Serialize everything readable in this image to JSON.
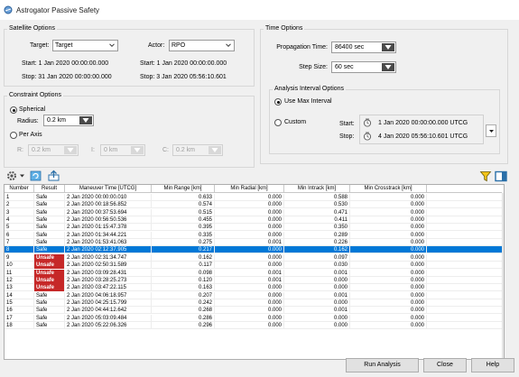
{
  "window": {
    "title": "Astrogator Passive Safety"
  },
  "satellite_options": {
    "title": "Satellite Options",
    "target_label": "Target:",
    "target_value": "Target",
    "actor_label": "Actor:",
    "actor_value": "RPO",
    "target_start": "Start: 1 Jan 2020 00:00:00.000",
    "target_stop": "Stop: 31 Jan 2020 00:00:00.000",
    "actor_start": "Start: 1 Jan 2020 00:00:00.000",
    "actor_stop": "Stop: 3 Jan 2020 05:56:10.601"
  },
  "constraint_options": {
    "title": "Constraint Options",
    "spherical_label": "Spherical",
    "radius_label": "Radius:",
    "radius_value": "0.2 km",
    "per_axis_label": "Per Axis",
    "r_label": "R:",
    "r_value": "0.2 km",
    "i_label": "I:",
    "i_value": "0 km",
    "c_label": "C:",
    "c_value": "0.2 km"
  },
  "time_options": {
    "title": "Time Options",
    "propagation_time_label": "Propagation Time:",
    "propagation_time_value": "86400 sec",
    "step_size_label": "Step Size:",
    "step_size_value": "60 sec",
    "analysis_interval": {
      "title": "Analysis Interval Options",
      "use_max_label": "Use Max Interval",
      "custom_label": "Custom",
      "start_label": "Start:",
      "start_value": "1 Jan 2020 00:00:00.000 UTCG",
      "stop_label": "Stop:",
      "stop_value": "4 Jan 2020 05:56:10.601 UTCG"
    }
  },
  "table": {
    "headers": [
      "Number",
      "Result",
      "Maneuver Time [UTCG]",
      "Min Range [km]",
      "Min Radial [km]",
      "Min Intrack [km]",
      "Min Crosstrack [km]"
    ],
    "rows": [
      [
        "1",
        "Safe",
        "2 Jan 2020 00:00:00.010",
        "0.633",
        "0.000",
        "0.588",
        "0.000"
      ],
      [
        "2",
        "Safe",
        "2 Jan 2020 00:18:56.852",
        "0.574",
        "0.000",
        "0.530",
        "0.000"
      ],
      [
        "3",
        "Safe",
        "2 Jan 2020 00:37:53.694",
        "0.515",
        "0.000",
        "0.471",
        "0.000"
      ],
      [
        "4",
        "Safe",
        "2 Jan 2020 00:56:50.536",
        "0.455",
        "0.000",
        "0.411",
        "0.000"
      ],
      [
        "5",
        "Safe",
        "2 Jan 2020 01:15:47.378",
        "0.395",
        "0.000",
        "0.350",
        "0.000"
      ],
      [
        "6",
        "Safe",
        "2 Jan 2020 01:34:44.221",
        "0.335",
        "0.000",
        "0.289",
        "0.000"
      ],
      [
        "7",
        "Safe",
        "2 Jan 2020 01:53:41.063",
        "0.275",
        "0.001",
        "0.226",
        "0.000"
      ],
      [
        "8",
        "Safe",
        "2 Jan 2020 02:12:37.905",
        "0.217",
        "0.000",
        "0.162",
        "0.000"
      ],
      [
        "9",
        "Unsafe",
        "2 Jan 2020 02:31:34.747",
        "0.162",
        "0.000",
        "0.097",
        "0.000"
      ],
      [
        "10",
        "Unsafe",
        "2 Jan 2020 02:50:31.589",
        "0.117",
        "0.000",
        "0.030",
        "0.000"
      ],
      [
        "11",
        "Unsafe",
        "2 Jan 2020 03:09:28.431",
        "0.098",
        "0.001",
        "0.001",
        "0.000"
      ],
      [
        "12",
        "Unsafe",
        "2 Jan 2020 03:28:25.273",
        "0.120",
        "0.001",
        "0.000",
        "0.000"
      ],
      [
        "13",
        "Unsafe",
        "2 Jan 2020 03:47:22.115",
        "0.163",
        "0.000",
        "0.000",
        "0.000"
      ],
      [
        "14",
        "Safe",
        "2 Jan 2020 04:06:18.957",
        "0.207",
        "0.000",
        "0.001",
        "0.000"
      ],
      [
        "15",
        "Safe",
        "2 Jan 2020 04:25:15.799",
        "0.242",
        "0.000",
        "0.000",
        "0.000"
      ],
      [
        "16",
        "Safe",
        "2 Jan 2020 04:44:12.642",
        "0.268",
        "0.000",
        "0.001",
        "0.000"
      ],
      [
        "17",
        "Safe",
        "2 Jan 2020 05:03:09.484",
        "0.286",
        "0.000",
        "0.000",
        "0.000"
      ],
      [
        "18",
        "Safe",
        "2 Jan 2020 05:22:06.326",
        "0.296",
        "0.000",
        "0.000",
        "0.000"
      ]
    ],
    "selected_row": 8
  },
  "buttons": {
    "run": "Run Analysis",
    "close": "Close",
    "help": "Help"
  },
  "icons": {
    "settings": "settings-icon",
    "chevron": "chevron-down-icon",
    "export": "export-icon",
    "filter": "filter-icon",
    "panel": "panel-toggle-icon",
    "calendar": "calendar-icon"
  },
  "colors": {
    "unsafe": "#c62828",
    "selected": "#0078d7",
    "spin_button": "#4a4a4a",
    "filter": "#f5c518"
  }
}
